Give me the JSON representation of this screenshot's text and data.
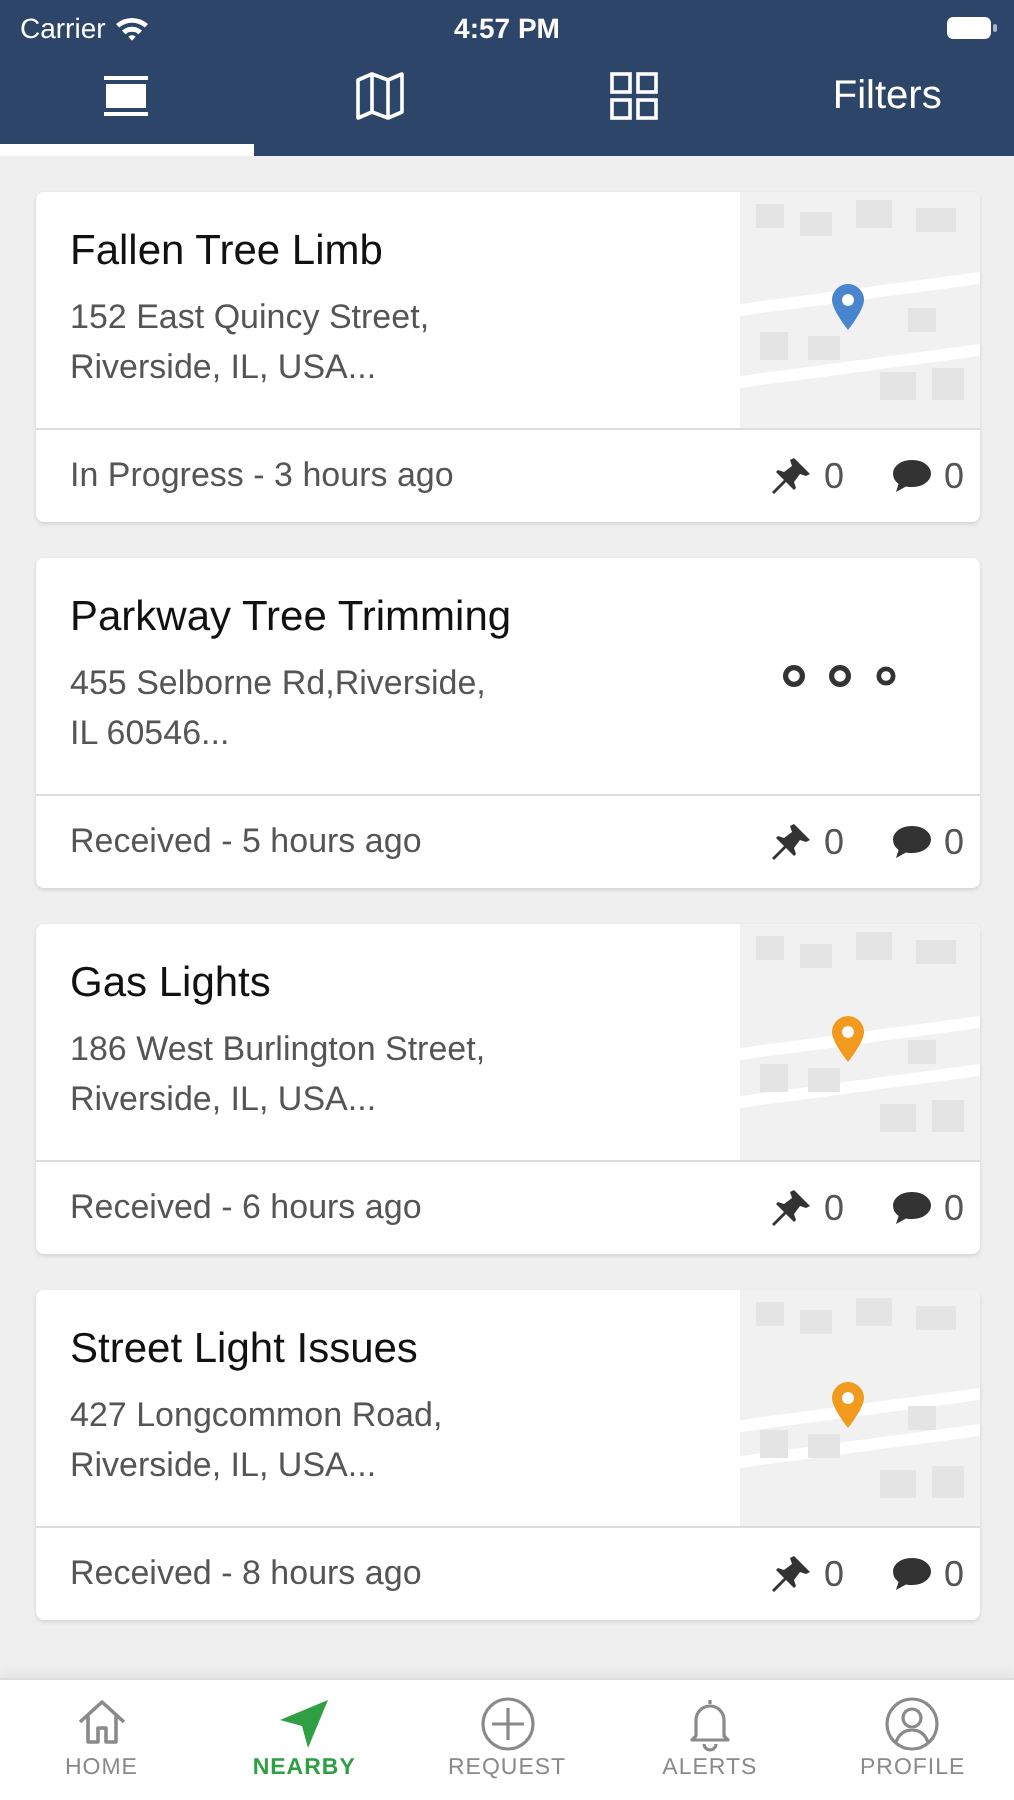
{
  "status_bar": {
    "carrier": "Carrier",
    "time": "4:57 PM"
  },
  "top_tabs": [
    {
      "kind": "list",
      "selected": true
    },
    {
      "kind": "map",
      "selected": false
    },
    {
      "kind": "grid",
      "selected": false
    },
    {
      "kind": "text",
      "label": "Filters",
      "selected": false
    }
  ],
  "requests": [
    {
      "title": "Fallen Tree Limb",
      "address": "152 East Quincy Street,\nRiverside, IL, USA...",
      "status": "In Progress - 3 hours ago",
      "pins": "0",
      "comments": "0",
      "preview": {
        "kind": "map",
        "color": "#4a86d0"
      }
    },
    {
      "title": "Parkway Tree Trimming",
      "address": "455 Selborne Rd,Riverside,\nIL 60546...",
      "status": "Received - 5 hours ago",
      "pins": "0",
      "comments": "0",
      "preview": {
        "kind": "loading"
      }
    },
    {
      "title": "Gas Lights",
      "address": "186 West Burlington Street,\nRiverside, IL, USA...",
      "status": "Received - 6 hours ago",
      "pins": "0",
      "comments": "0",
      "preview": {
        "kind": "map",
        "color": "#f29a1e"
      }
    },
    {
      "title": "Street Light Issues",
      "address": "427 Longcommon Road,\nRiverside, IL, USA...",
      "status": "Received - 8 hours ago",
      "pins": "0",
      "comments": "0",
      "preview": {
        "kind": "map",
        "color": "#f29a1e"
      }
    }
  ],
  "bottom_tabs": [
    {
      "kind": "home",
      "label": "HOME",
      "selected": false
    },
    {
      "kind": "nearby",
      "label": "NEARBY",
      "selected": true
    },
    {
      "kind": "request",
      "label": "REQUEST",
      "selected": false
    },
    {
      "kind": "alerts",
      "label": "ALERTS",
      "selected": false
    },
    {
      "kind": "profile",
      "label": "PROFILE",
      "selected": false
    }
  ]
}
